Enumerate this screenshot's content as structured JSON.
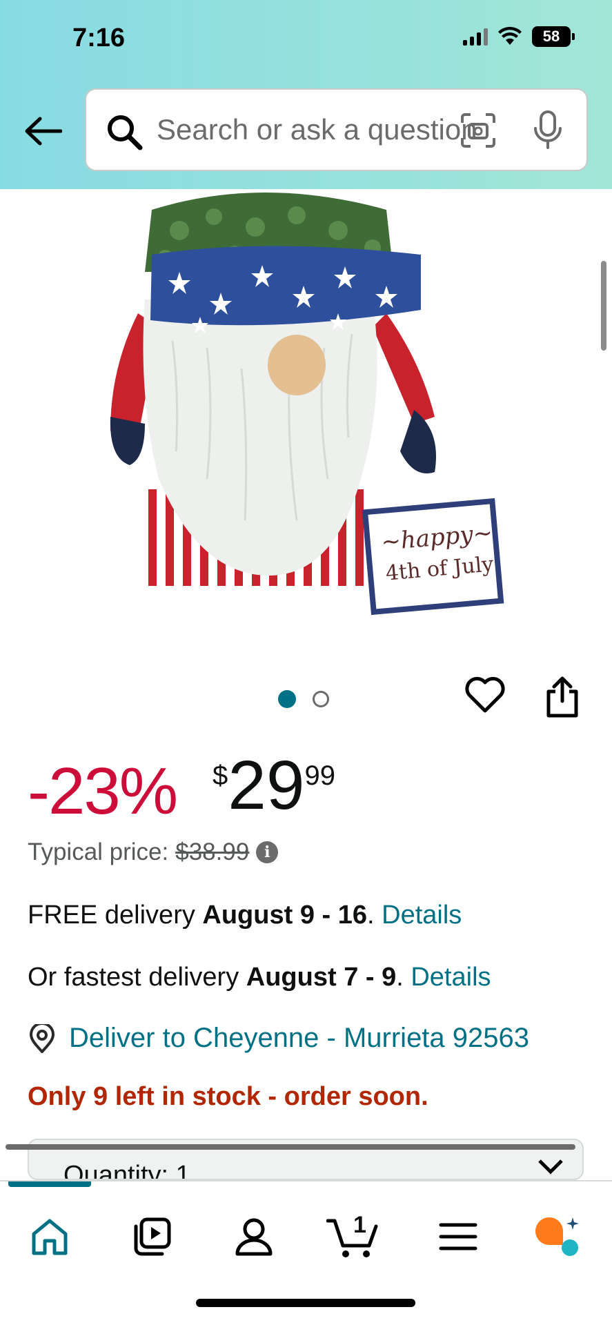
{
  "status_bar": {
    "time": "7:16",
    "battery": "58"
  },
  "search": {
    "placeholder": "Search or ask a question"
  },
  "icons": {
    "back": "back-arrow-icon",
    "search": "search-icon",
    "lens": "camera-lens-icon",
    "mic": "microphone-icon",
    "heart": "heart-icon",
    "share": "share-icon",
    "info": "info-icon",
    "location": "location-pin-icon"
  },
  "product": {
    "image_sign_text_1": "~happy~",
    "image_sign_text_2": "4th of July",
    "carousel_dots": 2,
    "carousel_active_index": 0
  },
  "pricing": {
    "discount": "-23%",
    "currency_symbol": "$",
    "price_whole": "29",
    "price_fraction": "99",
    "typical_label": "Typical price:",
    "typical_price": "$38.99"
  },
  "delivery": {
    "free_prefix": "FREE delivery ",
    "free_dates": "August 9 - 16",
    "free_suffix": ". ",
    "details_label": "Details",
    "fastest_prefix": "Or fastest delivery ",
    "fastest_dates": "August 7 - 9",
    "fastest_suffix": ". ",
    "deliver_to": "Deliver to Cheyenne - Murrieta 92563"
  },
  "stock": {
    "message": "Only 9 left in stock - order soon."
  },
  "quantity": {
    "label": "Quantity: 1"
  },
  "bottom_nav": {
    "items": [
      "home",
      "video",
      "account",
      "cart",
      "menu",
      "rufus"
    ],
    "cart_count": "1"
  },
  "colors": {
    "header_start": "#87dbe3",
    "header_end": "#a2e6d7",
    "discount_red": "#cc0c39",
    "link_teal": "#007185",
    "stock_red": "#b12704",
    "rufus_orange": "#ff7a1a",
    "rufus_teal": "#1fb5c4"
  }
}
